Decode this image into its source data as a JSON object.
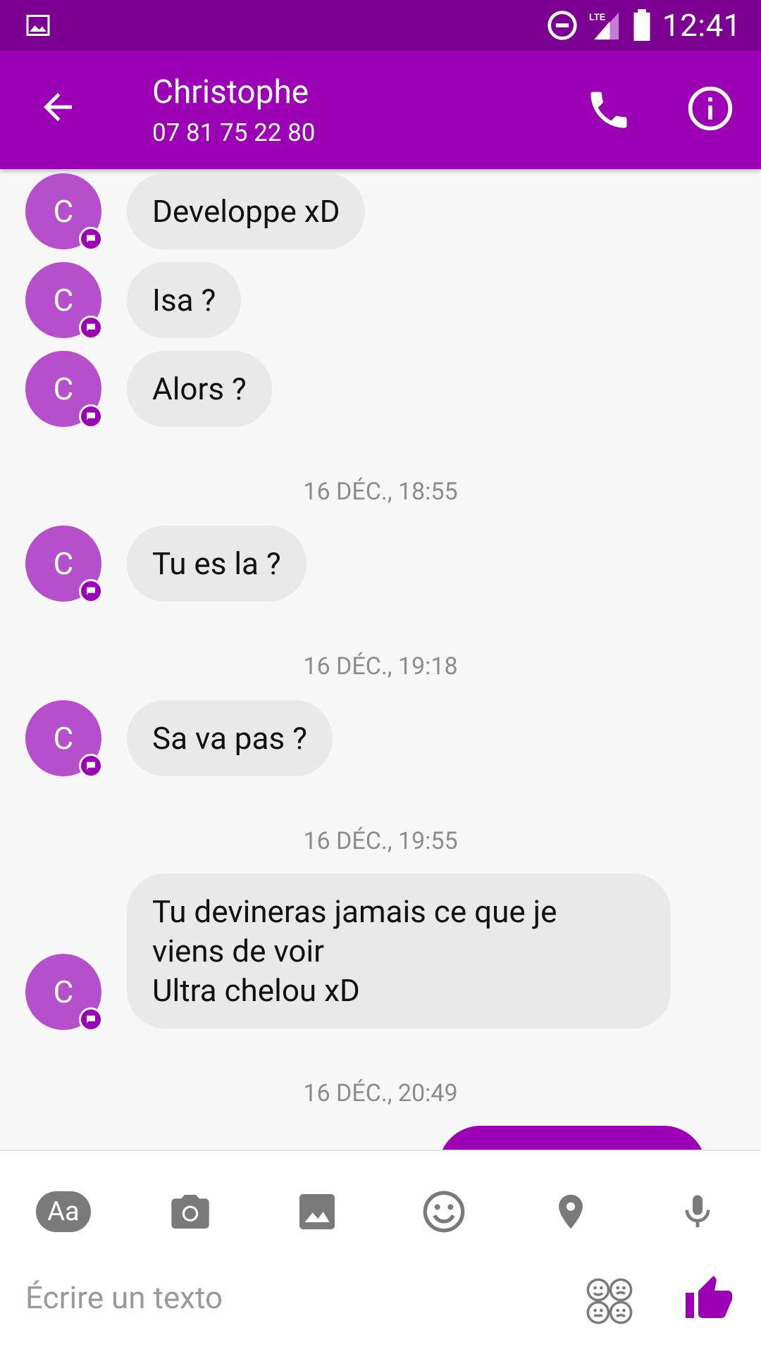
{
  "status_bar": {
    "time": "12:41",
    "network": "LTE"
  },
  "header": {
    "title": "Christophe",
    "subtitle": "07 81 75 22 80"
  },
  "messages": [
    {
      "avatar": "C",
      "text": "Developpe xD"
    },
    {
      "avatar": "C",
      "text": "Isa ?"
    },
    {
      "avatar": "C",
      "text": "Alors ?"
    },
    {
      "timestamp": "16 DÉC., 18:55"
    },
    {
      "avatar": "C",
      "text": "Tu es la ?"
    },
    {
      "timestamp": "16 DÉC., 19:18"
    },
    {
      "avatar": "C",
      "text": "Sa va pas ?"
    },
    {
      "timestamp": "16 DÉC., 19:55"
    },
    {
      "avatar": "C",
      "text": "Tu devineras jamais ce que je\nviens de voir\nUltra chelou xD"
    },
    {
      "timestamp": "16 DÉC., 20:49"
    }
  ],
  "composer": {
    "format_label": "Aa",
    "placeholder": "Écrire un texto",
    "tools": [
      "text-format-icon",
      "camera-icon",
      "gallery-icon",
      "emoji-icon",
      "location-icon",
      "microphone-icon"
    ],
    "accent": "#9b00b5"
  },
  "colors": {
    "status_bar": "#7b0091",
    "app_bar": "#9b00b5",
    "avatar": "#b64fcc",
    "bubble": "#e9e9e9"
  }
}
